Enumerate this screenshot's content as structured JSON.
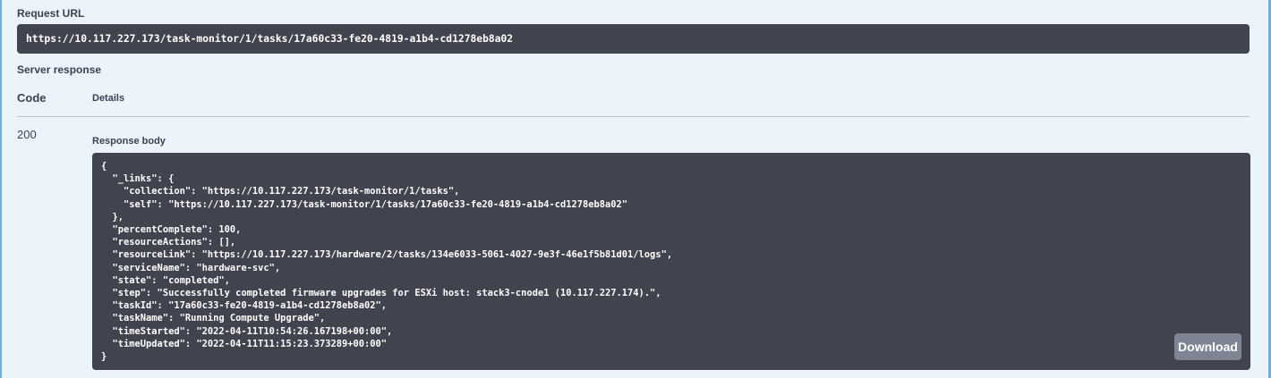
{
  "request": {
    "label": "Request URL",
    "url": "https://10.117.227.173/task-monitor/1/tasks/17a60c33-fe20-4819-a1b4-cd1278eb8a02"
  },
  "server_response": {
    "label": "Server response",
    "columns": {
      "code": "Code",
      "details": "Details"
    },
    "status_code": "200",
    "response_body_label": "Response body",
    "response_body_lines": [
      "{",
      "  \"_links\": {",
      "    \"collection\": \"https://10.117.227.173/task-monitor/1/tasks\",",
      "    \"self\": \"https://10.117.227.173/task-monitor/1/tasks/17a60c33-fe20-4819-a1b4-cd1278eb8a02\"",
      "  },",
      "  \"percentComplete\": 100,",
      "  \"resourceActions\": [],",
      "  \"resourceLink\": \"https://10.117.227.173/hardware/2/tasks/134e6033-5061-4027-9e3f-46e1f5b81d01/logs\",",
      "  \"serviceName\": \"hardware-svc\",",
      "  \"state\": \"completed\",",
      "  \"step\": \"Successfully completed firmware upgrades for ESXi host: stack3-cnode1 (10.117.227.174).\",",
      "  \"taskId\": \"17a60c33-fe20-4819-a1b4-cd1278eb8a02\",",
      "  \"taskName\": \"Running Compute Upgrade\",",
      "  \"timeStarted\": \"2022-04-11T10:54:26.167198+00:00\",",
      "  \"timeUpdated\": \"2022-04-11T11:15:23.373289+00:00\"",
      "}"
    ],
    "download_label": "Download"
  },
  "colors": {
    "page_background": "#ebf3fb",
    "code_background": "#41444e",
    "accent": "#61affe",
    "button_background": "#7d8492",
    "text": "#3b4151"
  }
}
